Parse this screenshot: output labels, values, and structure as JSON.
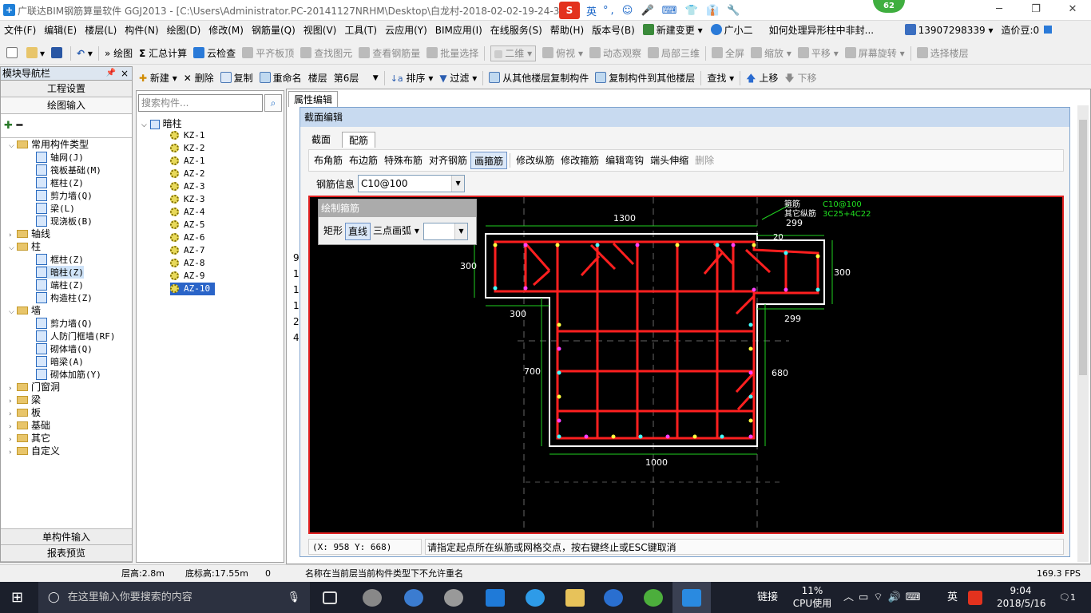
{
  "title": "广联达BIM钢筋算量软件 GGJ2013 - [C:\\Users\\Administrator.PC-20141127NRHM\\Desktop\\白龙村-2018-02-02-19-24-35",
  "notif_badge": "62",
  "ime": {
    "mode": "英",
    "glyphs": "°, ☺ 🎤 ⌨ 👕 👔 🔧"
  },
  "menu": [
    "文件(F)",
    "编辑(E)",
    "楼层(L)",
    "构件(N)",
    "绘图(D)",
    "修改(M)",
    "钢筋量(Q)",
    "视图(V)",
    "工具(T)",
    "云应用(Y)",
    "BIM应用(I)",
    "在线服务(S)",
    "帮助(H)",
    "版本号(B)",
    "新建变更",
    "广小二",
    "如何处理异形柱中非封...",
    "13907298339",
    "造价豆:0"
  ],
  "toolbar1": {
    "draw": "绘图",
    "sum": "汇总计算",
    "cloud_check": "云检查",
    "flat_top": "平齐板顶",
    "find_elem": "查找图元",
    "view_rebar": "查看钢筋量",
    "batch_select": "批量选择",
    "dim_mode": "二维",
    "top_view": "俯视",
    "dynamic_view": "动态观察",
    "local_3d": "局部三维",
    "full_screen": "全屏",
    "zoom": "缩放",
    "pan": "平移",
    "screen_rotate": "屏幕旋转",
    "select_floor": "选择楼层"
  },
  "nav": {
    "title": "模块导航栏",
    "buttons_top": [
      "工程设置",
      "绘图输入"
    ],
    "buttons_bottom": [
      "单构件输入",
      "报表预览"
    ],
    "tree": [
      {
        "label": "常用构件类型",
        "level": 0,
        "kind": "folder",
        "expanded": true
      },
      {
        "label": "轴网(J)",
        "level": 1,
        "kind": "comp"
      },
      {
        "label": "筏板基础(M)",
        "level": 1,
        "kind": "comp"
      },
      {
        "label": "框柱(Z)",
        "level": 1,
        "kind": "comp"
      },
      {
        "label": "剪力墙(Q)",
        "level": 1,
        "kind": "comp"
      },
      {
        "label": "梁(L)",
        "level": 1,
        "kind": "comp"
      },
      {
        "label": "现浇板(B)",
        "level": 1,
        "kind": "comp"
      },
      {
        "label": "轴线",
        "level": 0,
        "kind": "folder",
        "expanded": false
      },
      {
        "label": "柱",
        "level": 0,
        "kind": "folder",
        "expanded": true
      },
      {
        "label": "框柱(Z)",
        "level": 1,
        "kind": "comp"
      },
      {
        "label": "暗柱(Z)",
        "level": 1,
        "kind": "comp",
        "selected": true
      },
      {
        "label": "端柱(Z)",
        "level": 1,
        "kind": "comp"
      },
      {
        "label": "构造柱(Z)",
        "level": 1,
        "kind": "comp"
      },
      {
        "label": "墙",
        "level": 0,
        "kind": "folder",
        "expanded": true
      },
      {
        "label": "剪力墙(Q)",
        "level": 1,
        "kind": "comp"
      },
      {
        "label": "人防门框墙(RF)",
        "level": 1,
        "kind": "comp"
      },
      {
        "label": "砌体墙(Q)",
        "level": 1,
        "kind": "comp"
      },
      {
        "label": "暗梁(A)",
        "level": 1,
        "kind": "comp"
      },
      {
        "label": "砌体加筋(Y)",
        "level": 1,
        "kind": "comp"
      },
      {
        "label": "门窗洞",
        "level": 0,
        "kind": "folder",
        "expanded": false
      },
      {
        "label": "梁",
        "level": 0,
        "kind": "folder",
        "expanded": false
      },
      {
        "label": "板",
        "level": 0,
        "kind": "folder",
        "expanded": false
      },
      {
        "label": "基础",
        "level": 0,
        "kind": "folder",
        "expanded": false
      },
      {
        "label": "其它",
        "level": 0,
        "kind": "folder",
        "expanded": false
      },
      {
        "label": "自定义",
        "level": 0,
        "kind": "folder",
        "expanded": false
      }
    ]
  },
  "toolbar2": {
    "new": "新建",
    "delete": "删除",
    "copy": "复制",
    "rename": "重命名",
    "floor_label": "楼层",
    "floor": "第6层",
    "sort": "排序",
    "filter": "过滤",
    "copy_from": "从其他楼层复制构件",
    "copy_to": "复制构件到其他楼层",
    "find": "查找",
    "up": "上移",
    "down": "下移"
  },
  "complist": {
    "search_placeholder": "搜索构件...",
    "root": "暗柱",
    "items": [
      "KZ-1",
      "KZ-2",
      "AZ-1",
      "AZ-2",
      "AZ-3",
      "KZ-3",
      "AZ-4",
      "AZ-5",
      "AZ-6",
      "AZ-7",
      "AZ-8",
      "AZ-9",
      "AZ-10"
    ],
    "selected": "AZ-10"
  },
  "props": {
    "tab": "属性编辑",
    "row_hints": [
      "9",
      "1",
      "1",
      "1",
      "2",
      "4"
    ]
  },
  "dialog": {
    "title": "截面编辑",
    "tabs": [
      "截面",
      "配筋"
    ],
    "active_tab": "配筋",
    "tools": [
      "布角筋",
      "布边筋",
      "特殊布筋",
      "对齐钢筋",
      "画箍筋",
      "修改纵筋",
      "修改箍筋",
      "编辑弯钩",
      "端头伸缩",
      "删除"
    ],
    "active_tool": "画箍筋",
    "rebar_info_label": "钢筋信息",
    "rebar_info_value": "C10@100",
    "draw_stirrup": {
      "title": "绘制箍筋",
      "options": [
        "矩形",
        "直线",
        "三点画弧"
      ],
      "selected": "直线"
    },
    "coord": "(X: 958 Y: 668)",
    "prompt": "请指定起点所在纵筋或网格交点，按右键终止或ESC键取消"
  },
  "cad": {
    "dims": {
      "top": "1300",
      "left": "300",
      "left_bottom": "300",
      "left_lower": "700",
      "bottom": "1000",
      "right_top": "299",
      "right_mid": "300",
      "right_low": "299",
      "right_lower": "680",
      "small": "20"
    },
    "labels": {
      "stirrup": "箍筋",
      "other": "其它纵筋",
      "stirrup_val": "C10@100",
      "other_val": "3C25+4C22"
    },
    "colors": {
      "rebar": "#ff1f1f",
      "outline": "#ffffff",
      "dim": "#20d020",
      "grid": "#808080",
      "label": "#20e020"
    }
  },
  "status": {
    "floor_height": "层高:2.8m",
    "base_height": "底标高:17.55m",
    "zero": "0",
    "message": "名称在当前层当前构件类型下不允许重名",
    "fps": "169.3 FPS"
  },
  "taskbar": {
    "search": "在这里输入你要搜索的内容",
    "link": "链接",
    "cpu_pct": "11%",
    "cpu_label": "CPU使用",
    "ime": "英",
    "time": "9:04",
    "date": "2018/5/16",
    "notif": "1"
  }
}
